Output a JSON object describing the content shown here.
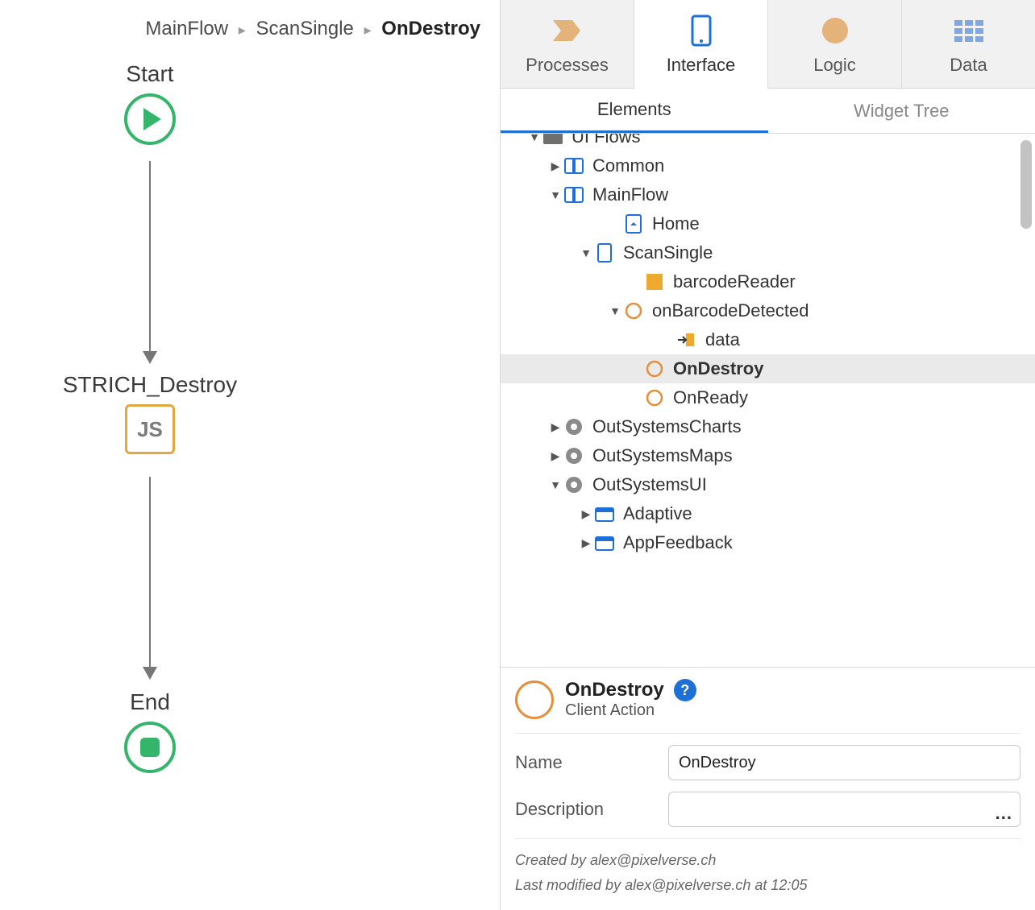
{
  "breadcrumb": {
    "a": "MainFlow",
    "b": "ScanSingle",
    "c": "OnDestroy"
  },
  "flow": {
    "start": "Start",
    "mid": "STRICH_Destroy",
    "js": "JS",
    "end": "End"
  },
  "mainTabs": {
    "processes": "Processes",
    "interface": "Interface",
    "logic": "Logic",
    "data": "Data"
  },
  "subTabs": {
    "elements": "Elements",
    "widget": "Widget Tree"
  },
  "tree": {
    "uiflows": "UI Flows",
    "common": "Common",
    "mainflow": "MainFlow",
    "home": "Home",
    "scansingle": "ScanSingle",
    "barcodereader": "barcodeReader",
    "onbarcodedetected": "onBarcodeDetected",
    "data": "data",
    "ondestroy": "OnDestroy",
    "onready": "OnReady",
    "outsystemscharts": "OutSystemsCharts",
    "outsystemsmaps": "OutSystemsMaps",
    "outsystemsui": "OutSystemsUI",
    "adaptive": "Adaptive",
    "appfeedback": "AppFeedback"
  },
  "props": {
    "title": "OnDestroy",
    "type": "Client Action",
    "nameLabel": "Name",
    "nameValue": "OnDestroy",
    "descLabel": "Description",
    "descValue": "",
    "created": "Created by alex@pixelverse.ch",
    "modified": "Last modified by alex@pixelverse.ch at 12:05"
  }
}
